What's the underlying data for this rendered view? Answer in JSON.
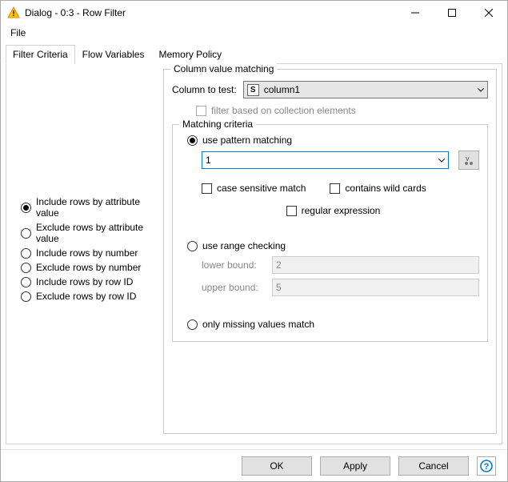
{
  "window": {
    "title": "Dialog - 0:3 - Row Filter"
  },
  "menu": {
    "file": "File"
  },
  "tabs": [
    {
      "label": "Filter Criteria",
      "active": true
    },
    {
      "label": "Flow Variables",
      "active": false
    },
    {
      "label": "Memory Policy",
      "active": false
    }
  ],
  "filter_modes": {
    "include_attr": "Include rows by attribute value",
    "exclude_attr": "Exclude rows by attribute value",
    "include_num": "Include rows by number",
    "exclude_num": "Exclude rows by number",
    "include_id": "Include rows by row ID",
    "exclude_id": "Exclude rows by row ID",
    "selected": "include_attr"
  },
  "column_matching": {
    "legend": "Column value matching",
    "column_label": "Column to test:",
    "column_type": "S",
    "column_value": "column1",
    "filter_collection": "filter based on collection elements",
    "filter_collection_enabled": false
  },
  "matching_criteria": {
    "legend": "Matching criteria",
    "use_pattern": "use pattern matching",
    "pattern_value": "1",
    "case_sensitive": "case sensitive match",
    "wild_cards": "contains wild cards",
    "regex": "regular expression",
    "use_range": "use range checking",
    "lower_label": "lower bound:",
    "lower_value": "2",
    "upper_label": "upper bound:",
    "upper_value": "5",
    "only_missing": "only missing values match",
    "selected": "use_pattern"
  },
  "buttons": {
    "ok": "OK",
    "apply": "Apply",
    "cancel": "Cancel"
  },
  "icons": {
    "help": "?"
  }
}
